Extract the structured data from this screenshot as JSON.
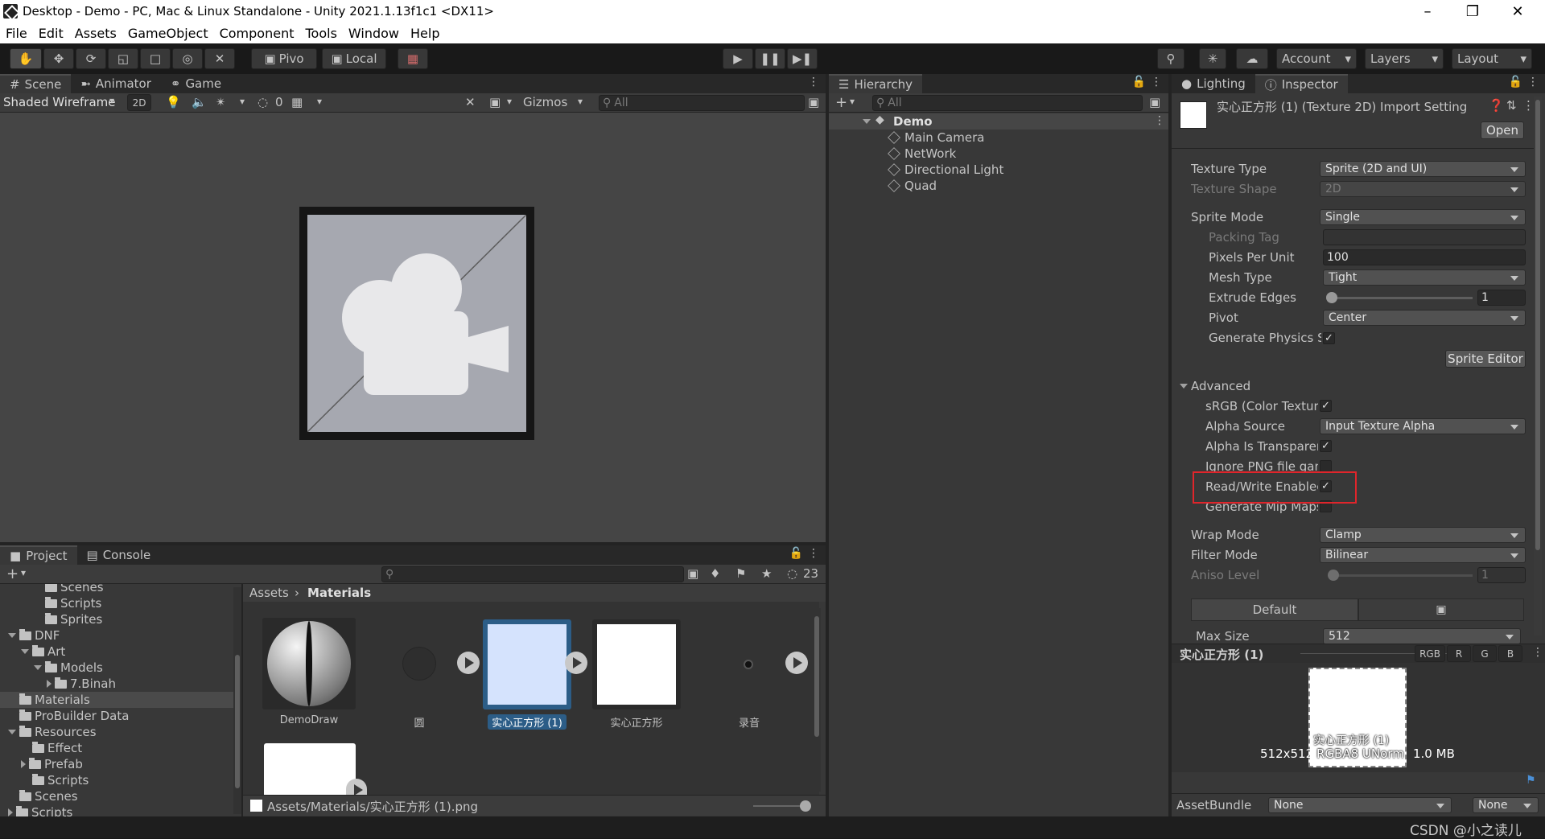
{
  "window": {
    "title": "Desktop - Demo - PC, Mac & Linux Standalone - Unity 2021.1.13f1c1 <DX11>"
  },
  "menu": [
    "File",
    "Edit",
    "Assets",
    "GameObject",
    "Component",
    "Tools",
    "Window",
    "Help"
  ],
  "toolbar": {
    "pivot": "Pivo",
    "local": "Local",
    "account": "Account",
    "layers": "Layers",
    "layout": "Layout"
  },
  "scene": {
    "tabs": [
      "Scene",
      "Animator",
      "Game"
    ],
    "shading": "Shaded Wireframe",
    "mode2d": "2D",
    "hidden_count": "0",
    "gizmos": "Gizmos",
    "search_placeholder": "All"
  },
  "hierarchy": {
    "tab": "Hierarchy",
    "search_placeholder": "All",
    "scene": "Demo",
    "items": [
      "Main Camera",
      "NetWork",
      "Directional Light",
      "Quad"
    ]
  },
  "inspector": {
    "tabs": [
      "Lighting",
      "Inspector"
    ],
    "title": "实心正方形 (1) (Texture 2D) Import Setting",
    "open": "Open",
    "rows": [
      {
        "label": "Texture Type",
        "value": "Sprite (2D and UI)"
      },
      {
        "label": "Texture Shape",
        "value": "2D"
      },
      {
        "label": "Sprite Mode",
        "value": "Single"
      },
      {
        "label": "Packing Tag",
        "value": ""
      },
      {
        "label": "Pixels Per Unit",
        "value": "100"
      },
      {
        "label": "Mesh Type",
        "value": "Tight"
      },
      {
        "label": "Extrude Edges",
        "value": "1"
      },
      {
        "label": "Pivot",
        "value": "Center"
      },
      {
        "label": "Generate Physics S",
        "value": "✓"
      }
    ],
    "sprite_editor": "Sprite Editor",
    "advanced": "Advanced",
    "adv_rows": [
      {
        "label": "sRGB (Color Textur",
        "value": "✓"
      },
      {
        "label": "Alpha Source",
        "value": "Input Texture Alpha"
      },
      {
        "label": "Alpha Is Transparer",
        "value": "✓"
      },
      {
        "label": "Ignore PNG file gam",
        "value": ""
      },
      {
        "label": "Read/Write Enablec",
        "value": "✓"
      },
      {
        "label": "Generate Mip Maps",
        "value": ""
      }
    ],
    "wrap": {
      "label": "Wrap Mode",
      "value": "Clamp"
    },
    "filter": {
      "label": "Filter Mode",
      "value": "Bilinear"
    },
    "aniso": {
      "label": "Aniso Level",
      "value": "1"
    },
    "platform_default": "Default",
    "max_size": {
      "label": "Max Size",
      "value": "512"
    },
    "preview": {
      "name": "实心正方形 (1)",
      "channels": [
        "RGB",
        "R",
        "G",
        "B"
      ],
      "size": "512x512",
      "format": "RGBA8 UNorm",
      "bytes": "1.0 MB",
      "overlay_name": "实心正方形 (1)"
    },
    "assetbundle": {
      "label": "AssetBundle",
      "value": "None",
      "variant": "None"
    }
  },
  "project": {
    "tabs": [
      "Project",
      "Console"
    ],
    "hidden_count": "23",
    "breadcrumb": [
      "Assets",
      "Materials"
    ],
    "tree": [
      {
        "label": "Scenes",
        "indent": 3,
        "arrow": "none"
      },
      {
        "label": "Scripts",
        "indent": 3,
        "arrow": "none"
      },
      {
        "label": "Sprites",
        "indent": 3,
        "arrow": "none"
      },
      {
        "label": "DNF",
        "indent": 1,
        "arrow": "down"
      },
      {
        "label": "Art",
        "indent": 2,
        "arrow": "down"
      },
      {
        "label": "Models",
        "indent": 3,
        "arrow": "down"
      },
      {
        "label": "7.Binah",
        "indent": 4,
        "arrow": "right"
      },
      {
        "label": "Materials",
        "indent": 1,
        "arrow": "none",
        "selected": true
      },
      {
        "label": "ProBuilder Data",
        "indent": 1,
        "arrow": "none"
      },
      {
        "label": "Resources",
        "indent": 1,
        "arrow": "down"
      },
      {
        "label": "Effect",
        "indent": 2,
        "arrow": "none"
      },
      {
        "label": "Prefab",
        "indent": 2,
        "arrow": "right"
      },
      {
        "label": "Scripts",
        "indent": 2,
        "arrow": "none"
      },
      {
        "label": "Scenes",
        "indent": 1,
        "arrow": "none"
      },
      {
        "label": "Scripts",
        "indent": 1,
        "arrow": "right"
      }
    ],
    "assets": [
      "DemoDraw",
      "圆",
      "实心正方形 (1)",
      "实心正方形",
      "录音"
    ],
    "status_path": "Assets/Materials/实心正方形 (1).png"
  },
  "watermark": "CSDN @小之读儿",
  "colors": {
    "highlight_box": "#e0252b",
    "selection": "#2c5d87",
    "accent_blue": "#4a8fd6"
  }
}
